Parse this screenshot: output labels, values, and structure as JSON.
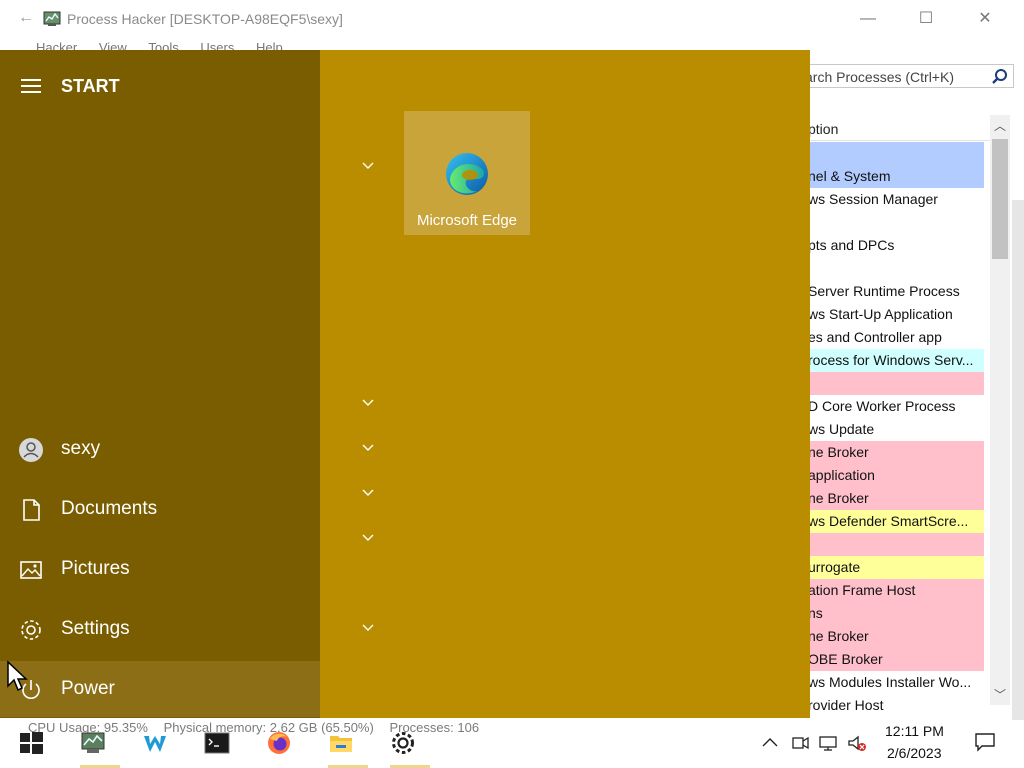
{
  "process_hacker": {
    "title": "Process Hacker [DESKTOP-A98EQF5\\sexy]",
    "menu": [
      "Hacker",
      "View",
      "Tools",
      "Users",
      "Help"
    ],
    "search_placeholder": "arch Processes (Ctrl+K)",
    "column_header": "ption",
    "rows": [
      {
        "text": "",
        "color": "#b3ccff"
      },
      {
        "text": "nel & System",
        "color": "#b3ccff"
      },
      {
        "text": "ws Session Manager",
        "color": "#ffffff"
      },
      {
        "text": "",
        "color": "#ffffff"
      },
      {
        "text": "pts and DPCs",
        "color": "#ffffff"
      },
      {
        "text": "",
        "color": "#ffffff"
      },
      {
        "text": "Server Runtime Process",
        "color": "#ffffff"
      },
      {
        "text": "ws Start-Up Application",
        "color": "#ffffff"
      },
      {
        "text": "es and Controller app",
        "color": "#ffffff"
      },
      {
        "text": "rocess for Windows Serv...",
        "color": "#d0ffff"
      },
      {
        "text": "",
        "color": "#ffc0cb"
      },
      {
        "text": "D Core Worker Process",
        "color": "#ffffff"
      },
      {
        "text": "ws Update",
        "color": "#ffffff"
      },
      {
        "text": "ne Broker",
        "color": "#ffc0cb"
      },
      {
        "text": " application",
        "color": "#ffc0cb"
      },
      {
        "text": "ne Broker",
        "color": "#ffc0cb"
      },
      {
        "text": "ws Defender SmartScre...",
        "color": "#ffff99"
      },
      {
        "text": "",
        "color": "#ffc0cb"
      },
      {
        "text": "urrogate",
        "color": "#ffff99"
      },
      {
        "text": "ation Frame Host",
        "color": "#ffc0cb"
      },
      {
        "text": "ns",
        "color": "#ffc0cb"
      },
      {
        "text": "ne Broker",
        "color": "#ffc0cb"
      },
      {
        "text": "OBE Broker",
        "color": "#ffc0cb"
      },
      {
        "text": "ws Modules Installer Wo...",
        "color": "#ffffff"
      },
      {
        "text": "rovider Host",
        "color": "#ffffff"
      }
    ],
    "status": {
      "cpu": "CPU Usage: 95.35%",
      "memory": "Physical memory: 2.62 GB (65.50%)",
      "processes": "Processes: 106"
    }
  },
  "start_menu": {
    "header": "START",
    "items": [
      {
        "label": "sexy",
        "icon": "user-icon"
      },
      {
        "label": "Documents",
        "icon": "document-icon"
      },
      {
        "label": "Pictures",
        "icon": "pictures-icon"
      },
      {
        "label": "Settings",
        "icon": "gear-icon"
      },
      {
        "label": "Power",
        "icon": "power-icon"
      }
    ],
    "tile": {
      "label": "Microsoft Edge",
      "icon": "edge-icon"
    },
    "colors": {
      "left": "#7a5d00",
      "right": "#ba8d00",
      "tile": "#c9a43a"
    }
  },
  "taskbar": {
    "apps": [
      "windows-start-icon",
      "process-hacker-icon",
      "wing-icon",
      "terminal-icon",
      "firefox-icon",
      "file-explorer-icon",
      "settings-icon"
    ],
    "tray_icons": [
      "chevron-up-icon",
      "meet-icon",
      "network-icon",
      "volume-muted-icon",
      "notification-icon"
    ],
    "time": "12:11 PM",
    "date": "2/6/2023"
  }
}
